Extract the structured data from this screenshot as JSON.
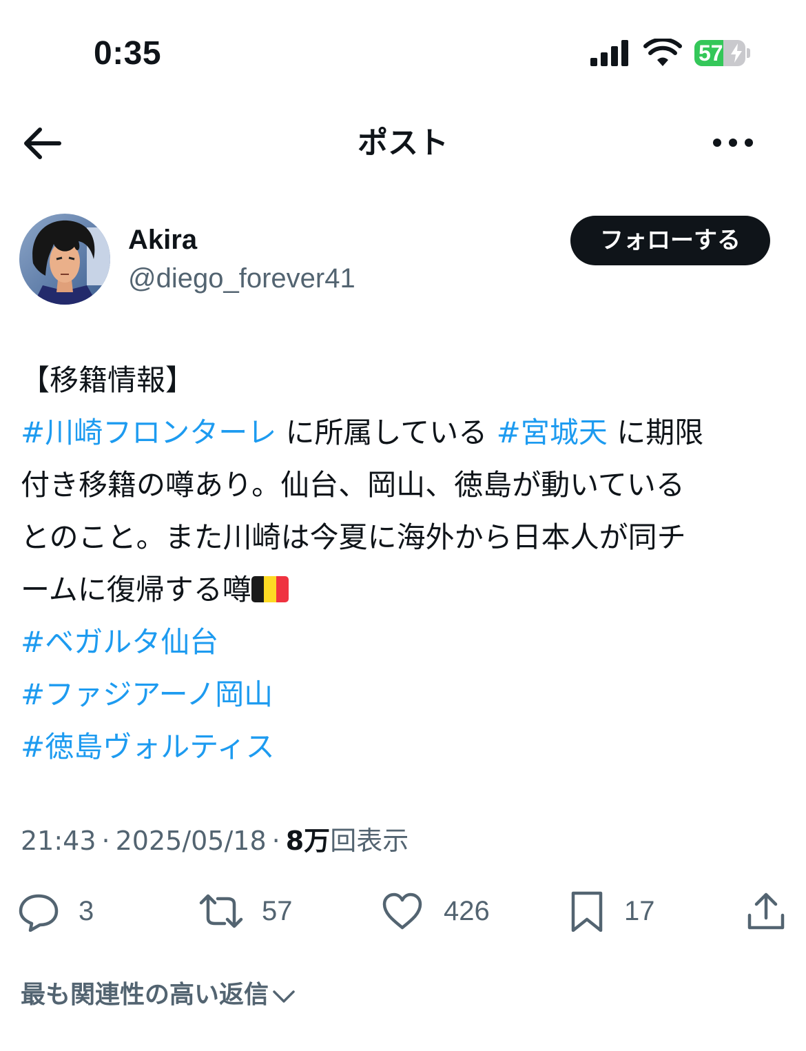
{
  "status_bar": {
    "time": "0:35",
    "battery_percent": "57",
    "battery_level": 0.57,
    "battery_charging": true,
    "colors": {
      "battery_fill": "#34c759"
    }
  },
  "nav": {
    "title": "ポスト",
    "back_icon": "arrow-left-icon",
    "more_icon": "more-horizontal-icon"
  },
  "author": {
    "name": "Akira",
    "handle": "@diego_forever41",
    "follow_label": "フォローする"
  },
  "post": {
    "lines": [
      [
        {
          "text": "【移籍情報】"
        }
      ],
      [
        {
          "text": "#川崎フロンターレ",
          "hashtag": true
        },
        {
          "text": " に所属している "
        },
        {
          "text": "#宮城天",
          "hashtag": true
        },
        {
          "text": " に期限"
        }
      ],
      [
        {
          "text": "付き移籍の噂あり。仙台、岡山、徳島が動いている"
        }
      ],
      [
        {
          "text": "とのこと。また川崎は今夏に海外から日本人が同チ"
        }
      ],
      [
        {
          "text": "ームに復帰する噂"
        },
        {
          "flag": "belgium"
        }
      ],
      [
        {
          "text": "#ベガルタ仙台",
          "hashtag": true
        }
      ],
      [
        {
          "text": "#ファジアーノ岡山",
          "hashtag": true
        }
      ],
      [
        {
          "text": "#徳島ヴォルティス",
          "hashtag": true
        }
      ]
    ],
    "colors": {
      "hashtag": "#1d9bf0",
      "text": "#0f1419",
      "secondary": "#536471"
    }
  },
  "meta": {
    "time": "21:43",
    "date": "2025/05/18",
    "separator": "·",
    "views_count": "8万",
    "views_label": "回表示"
  },
  "actions": [
    {
      "name": "reply",
      "icon": "reply-icon",
      "count": "3"
    },
    {
      "name": "repost",
      "icon": "repost-icon",
      "count": "57"
    },
    {
      "name": "like",
      "icon": "heart-icon",
      "count": "426"
    },
    {
      "name": "bookmark",
      "icon": "bookmark-icon",
      "count": "17"
    },
    {
      "name": "share",
      "icon": "share-icon",
      "count": ""
    }
  ],
  "replies": {
    "sort_label": "最も関連性の高い返信"
  }
}
